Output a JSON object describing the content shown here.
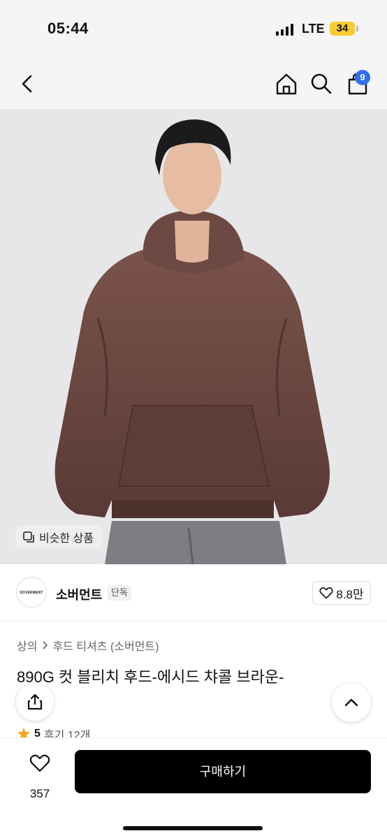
{
  "status_bar": {
    "time": "05:44",
    "network": "LTE",
    "battery": "34"
  },
  "nav": {
    "back_icon": "chevron-left-icon",
    "home_icon": "home-icon",
    "search_icon": "search-icon",
    "cart_icon": "shopping-bag-icon",
    "cart_count": "9"
  },
  "hero": {
    "similar_label": "비슷한 상품"
  },
  "brand": {
    "logo_text": "SOVERMENT",
    "name": "소버먼트",
    "tag": "단독",
    "likes": "8.8만"
  },
  "breadcrumb": {
    "category": "상의",
    "subcategory": "후드 티셔츠 (소버먼트)"
  },
  "product": {
    "title": "890G 컷 블리치 후드-에시드 챠콜 브라운-",
    "rating": "5",
    "reviews": "후기 12개"
  },
  "bottom": {
    "wish_count": "357",
    "buy_label": "구매하기"
  },
  "colors": {
    "accent_badge": "#2f6ef2",
    "battery": "#f7cc2f",
    "star": "#f5a623",
    "hoodie": "#6b4640"
  }
}
